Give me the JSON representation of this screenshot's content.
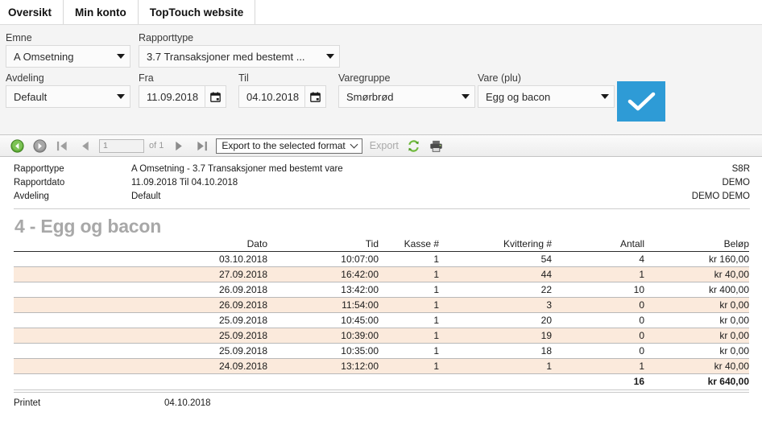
{
  "tabs": [
    {
      "label": "Oversikt"
    },
    {
      "label": "Min konto"
    },
    {
      "label": "TopTouch website"
    }
  ],
  "filters": {
    "emne": {
      "label": "Emne",
      "value": "A Omsetning"
    },
    "rapporttype": {
      "label": "Rapporttype",
      "value": "3.7 Transaksjoner med bestemt  ..."
    },
    "avdeling": {
      "label": "Avdeling",
      "value": "Default"
    },
    "fra": {
      "label": "Fra",
      "value": "11.09.2018"
    },
    "til": {
      "label": "Til",
      "value": "04.10.2018"
    },
    "varegruppe": {
      "label": "Varegruppe",
      "value": "Smørbrød"
    },
    "vare": {
      "label": "Vare (plu)",
      "value": "Egg og bacon"
    },
    "submit_icon": "checkmark-icon",
    "accent_color": "#2e9bd6"
  },
  "report_toolbar": {
    "back_icon": "back-circle-icon",
    "forward_icon": "forward-circle-icon",
    "first_page_icon": "first-page-icon",
    "prev_page_icon": "prev-page-icon",
    "page_value": "1",
    "page_of": "of 1",
    "next_page_icon": "next-page-icon",
    "last_page_icon": "last-page-icon",
    "export_format": "Export to the selected format",
    "export_label": "Export",
    "refresh_icon": "refresh-icon",
    "print_icon": "printer-icon"
  },
  "report": {
    "meta": [
      {
        "label": "Rapporttype",
        "value": "A Omsetning - 3.7 Transaksjoner med bestemt vare",
        "right": "S8R"
      },
      {
        "label": "Rapportdato",
        "value": "11.09.2018 Til 04.10.2018",
        "right": "DEMO"
      },
      {
        "label": "Avdeling",
        "value": "Default",
        "right": "DEMO DEMO"
      }
    ],
    "title": "4 - Egg og bacon",
    "columns": [
      "Dato",
      "Tid",
      "Kasse #",
      "Kvittering #",
      "Antall",
      "Beløp"
    ],
    "rows": [
      [
        "03.10.2018",
        "10:07:00",
        "1",
        "54",
        "4",
        "kr 160,00"
      ],
      [
        "27.09.2018",
        "16:42:00",
        "1",
        "44",
        "1",
        "kr 40,00"
      ],
      [
        "26.09.2018",
        "13:42:00",
        "1",
        "22",
        "10",
        "kr 400,00"
      ],
      [
        "26.09.2018",
        "11:54:00",
        "1",
        "3",
        "0",
        "kr 0,00"
      ],
      [
        "25.09.2018",
        "10:45:00",
        "1",
        "20",
        "0",
        "kr 0,00"
      ],
      [
        "25.09.2018",
        "10:39:00",
        "1",
        "19",
        "0",
        "kr 0,00"
      ],
      [
        "25.09.2018",
        "10:35:00",
        "1",
        "18",
        "0",
        "kr 0,00"
      ],
      [
        "24.09.2018",
        "13:12:00",
        "1",
        "1",
        "1",
        "kr 40,00"
      ]
    ],
    "total": {
      "antall": "16",
      "belop": "kr 640,00"
    },
    "printed": {
      "label": "Printet",
      "value": "04.10.2018"
    },
    "alt_row_color": "#fbeadc"
  }
}
